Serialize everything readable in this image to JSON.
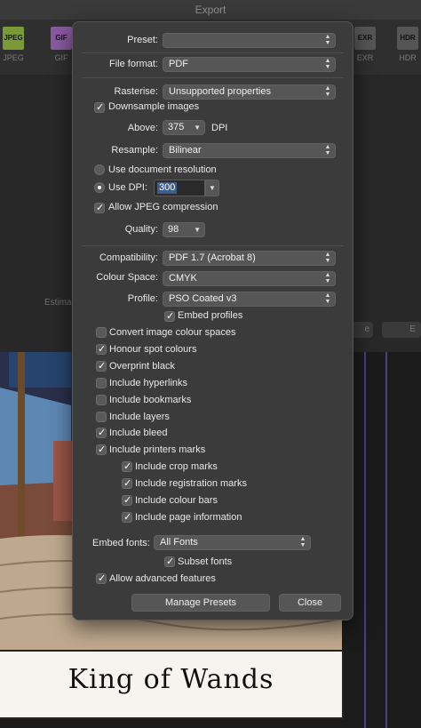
{
  "window": {
    "title": "Export"
  },
  "formats": [
    {
      "label": "JPEG",
      "tag": "JPEG",
      "color": "#7a9a3a"
    },
    {
      "label": "GIF",
      "tag": "GIF",
      "color": "#8a5aa0"
    },
    {
      "label": "EXR",
      "tag": "EXR",
      "color": "#777777"
    },
    {
      "label": "HDR",
      "tag": "HDR",
      "color": "#777777"
    }
  ],
  "background": {
    "estimate_label": "Estima",
    "btn_right_a": "e",
    "btn_right_b": "E"
  },
  "card": {
    "title": "King of Wands"
  },
  "dialog": {
    "preset": {
      "label": "Preset:",
      "value": ""
    },
    "file_format": {
      "label": "File format:",
      "value": "PDF"
    },
    "rasterise": {
      "label": "Rasterise:",
      "value": "Unsupported properties"
    },
    "downsample": {
      "label": "Downsample images",
      "checked": true
    },
    "above": {
      "label": "Above:",
      "value": "375",
      "unit": "DPI"
    },
    "resample": {
      "label": "Resample:",
      "value": "Bilinear"
    },
    "use_doc_res": {
      "label": "Use document resolution",
      "selected": false
    },
    "use_dpi": {
      "label": "Use DPI:",
      "value": "300",
      "selected": true
    },
    "allow_jpeg": {
      "label": "Allow JPEG compression",
      "checked": true
    },
    "quality": {
      "label": "Quality:",
      "value": "98"
    },
    "compatibility": {
      "label": "Compatibility:",
      "value": "PDF 1.7 (Acrobat 8)"
    },
    "colour_space": {
      "label": "Colour Space:",
      "value": "CMYK"
    },
    "profile": {
      "label": "Profile:",
      "value": "PSO Coated v3"
    },
    "embed_profiles": {
      "label": "Embed profiles",
      "checked": true
    },
    "options": [
      {
        "label": "Convert image colour spaces",
        "checked": false
      },
      {
        "label": "Honour spot colours",
        "checked": true
      },
      {
        "label": "Overprint black",
        "checked": true
      },
      {
        "label": "Include hyperlinks",
        "checked": false
      },
      {
        "label": "Include bookmarks",
        "checked": false
      },
      {
        "label": "Include layers",
        "checked": false
      },
      {
        "label": "Include bleed",
        "checked": true
      },
      {
        "label": "Include printers marks",
        "checked": true
      }
    ],
    "printer_marks": [
      {
        "label": "Include crop marks",
        "checked": true
      },
      {
        "label": "Include registration marks",
        "checked": true
      },
      {
        "label": "Include colour bars",
        "checked": true
      },
      {
        "label": "Include page information",
        "checked": true
      }
    ],
    "embed_fonts": {
      "label": "Embed  fonts:",
      "value": "All Fonts"
    },
    "subset_fonts": {
      "label": "Subset fonts",
      "checked": true
    },
    "allow_advanced": {
      "label": "Allow advanced features",
      "checked": true
    },
    "manage_presets": "Manage Presets",
    "close": "Close"
  }
}
